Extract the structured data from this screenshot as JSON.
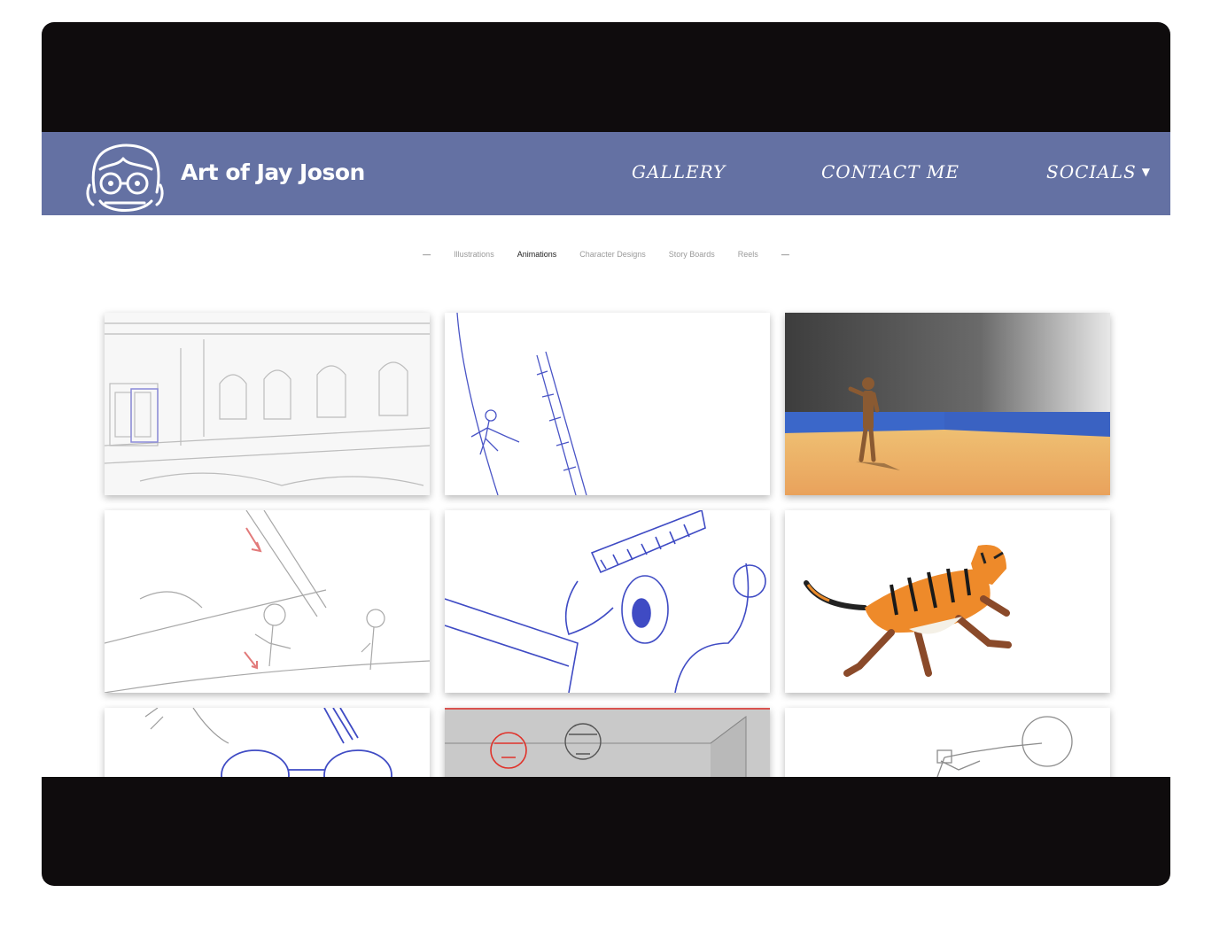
{
  "header": {
    "site_title": "Art of Jay Joson",
    "nav": [
      {
        "label": "GALLERY"
      },
      {
        "label": "CONTACT ME"
      },
      {
        "label": "SOCIALS",
        "icon": "caret-down-icon"
      }
    ],
    "background_color": "#6471a3"
  },
  "filters": {
    "left_dash": "—",
    "items": [
      {
        "label": "Illustrations",
        "active": false
      },
      {
        "label": "Animations",
        "active": true
      },
      {
        "label": "Character Designs",
        "active": false
      },
      {
        "label": "Story Boards",
        "active": false
      },
      {
        "label": "Reels",
        "active": false
      }
    ],
    "right_dash": "—"
  },
  "gallery": {
    "tiles": [
      {
        "subject": "pencil sketch of palace hall interior"
      },
      {
        "subject": "blue rough animation of character leaping"
      },
      {
        "subject": "3D mannequin on orange floor"
      },
      {
        "subject": "pencil storyboard with red arrows"
      },
      {
        "subject": "blue sketch close-up of character face"
      },
      {
        "subject": "colored tiger leaping"
      },
      {
        "subject": "blue sketch of character with glasses"
      },
      {
        "subject": "grey storyboard with red character"
      },
      {
        "subject": "pencil sketch of fighter punching"
      }
    ]
  }
}
